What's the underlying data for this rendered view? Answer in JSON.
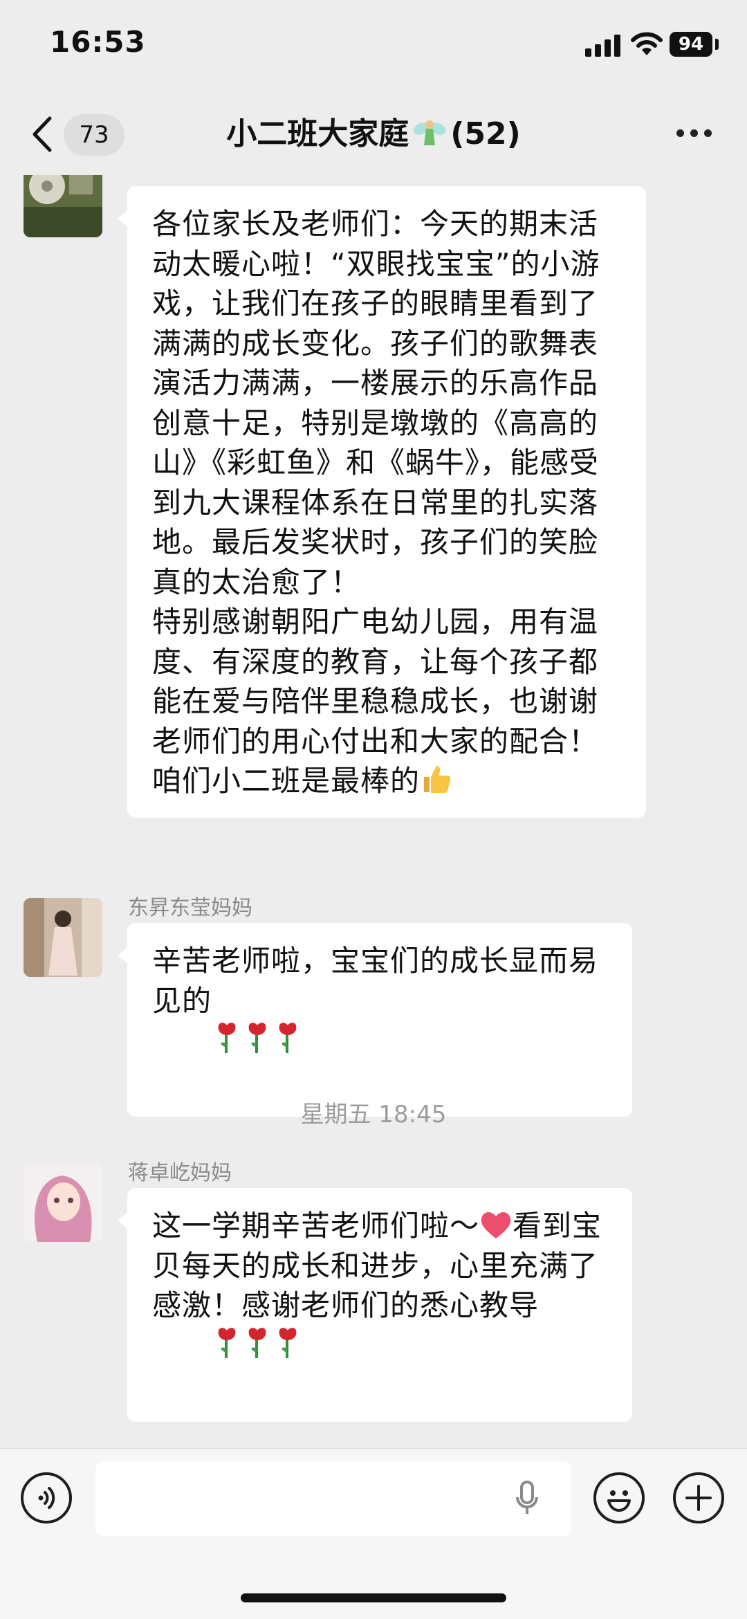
{
  "status_bar": {
    "time": "16:53",
    "battery": "94"
  },
  "nav": {
    "unread_count": "73",
    "title": "小二班大家庭",
    "member_count": "(52)"
  },
  "messages": [
    {
      "sender": "",
      "text": "各位家长及老师们：今天的期末活动太暖心啦！“双眼找宝宝”的小游戏，让我们在孩子的眼睛里看到了满满的成长变化。孩子们的歌舞表演活力满满，一楼展示的乐高作品创意十足，特别是墩墩的《高高的山》《彩虹鱼》和《蜗牛》，能感受到九大课程体系在日常里的扎实落地。最后发奖状时，孩子们的笑脸真的太治愈了！\n特别感谢朝阳广电幼儿园，用有温度、有深度的教育，让每个孩子都能在爱与陪伴里稳稳成长，也谢谢老师们的用心付出和大家的配合！咱们小二班是最棒的",
      "trailing_emoji": "thumbs-up"
    },
    {
      "sender": "东昇东莹妈妈",
      "text": "辛苦老师啦，宝宝们的成长显而易见的",
      "trailing_emoji": "rose x3"
    },
    {
      "timestamp": "星期五 18:45"
    },
    {
      "sender": "蒋卓屹妈妈",
      "text_part1": "这一学期辛苦老师们啦～",
      "text_part2": "看到宝贝每天的成长和进步，心里充满了感激！感谢老师们的悉心教导",
      "trailing_emoji": "rose x3"
    }
  ],
  "input_bar": {
    "voice_icon": "voice-icon",
    "emoji_icon": "emoji-icon",
    "plus_icon": "plus-icon",
    "mic_icon": "mic-icon"
  },
  "colors": {
    "background": "#ededed",
    "bubble": "#ffffff",
    "meta_text": "#9c9c9c"
  }
}
